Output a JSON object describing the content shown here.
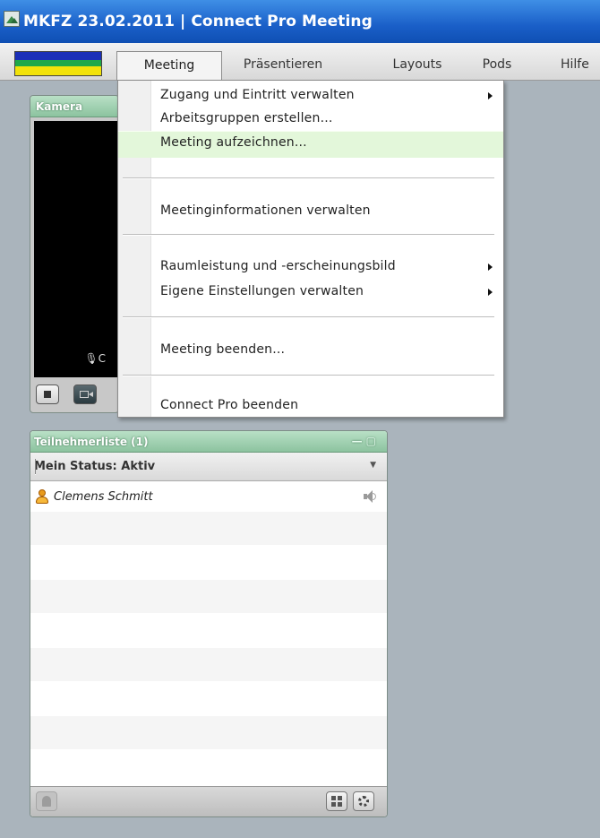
{
  "window": {
    "title": "MKFZ 23.02.2011  |  Connect Pro Meeting",
    "icon": "meeting-room-icon"
  },
  "menubar": {
    "items": [
      {
        "label": "Meeting",
        "active": true
      },
      {
        "label": "Präsentieren"
      },
      {
        "label": "Layouts"
      },
      {
        "label": "Pods"
      },
      {
        "label": "Hilfe"
      }
    ]
  },
  "dropdown": {
    "items": [
      {
        "label": "Zugang und Eintritt verwalten",
        "submenu": true
      },
      {
        "label": "Arbeitsgruppen erstellen..."
      },
      {
        "label": "Meeting aufzeichnen...",
        "highlighted": true
      },
      {
        "label": "Meetinginformationen verwalten"
      },
      {
        "label": "Raumleistung und -erscheinungsbild",
        "submenu": true
      },
      {
        "label": "Eigene Einstellungen verwalten",
        "submenu": true
      },
      {
        "label": "Meeting beenden..."
      },
      {
        "label": "Connect Pro beenden"
      }
    ]
  },
  "camera_pod": {
    "title": "Kamera",
    "mic_label": "C"
  },
  "participants_pod": {
    "title": "Teilnehmerliste (1)",
    "window_controls": "—▢",
    "status_label": "Mein Status: Aktiv",
    "participants": [
      {
        "name": "Clemens Schmitt",
        "icon": "host-icon",
        "audio": "speaker-icon"
      }
    ]
  },
  "colors": {
    "titlebar": "#1a5fc8",
    "pod_header": "#8cc39f",
    "menu_highlight": "#e3f7da",
    "workspace": "#aab4bc"
  }
}
